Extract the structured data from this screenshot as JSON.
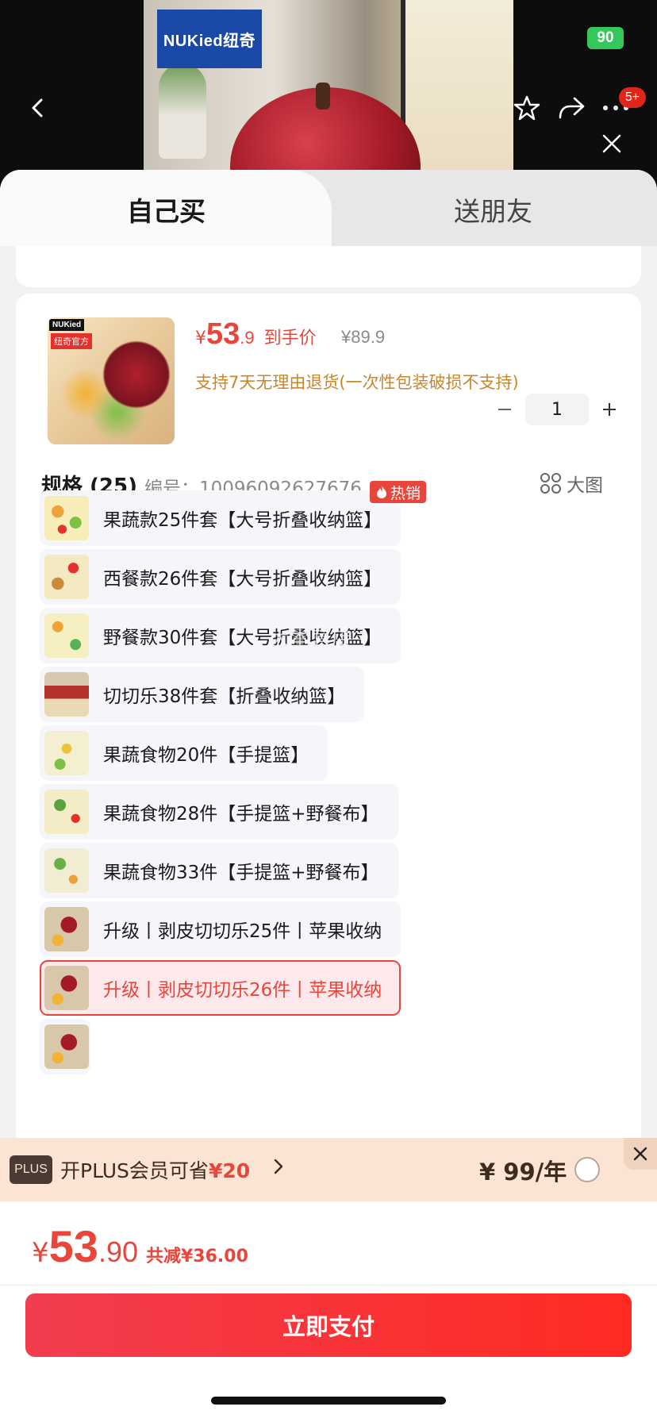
{
  "hero": {
    "brand_logo": "NUKied纽奇",
    "battery": "90",
    "cart_badge": "5+"
  },
  "tabs": [
    {
      "label": "自己买",
      "active": true
    },
    {
      "label": "送朋友",
      "active": false
    }
  ],
  "product": {
    "price_symbol": "¥",
    "price_int": "53",
    "price_dec": ".9",
    "price_tag": "到手价",
    "original_price": "¥89.9",
    "return_note": "支持7天无理由退货(一次性包装破损不支持)",
    "quantity": "1",
    "thumb_tag": "NUKied",
    "thumb_tag2": "纽奇官方"
  },
  "spec": {
    "title": "规格 (25)",
    "sku": "编号：10096092627676",
    "big_image_label": "大图",
    "hot_label": "热销",
    "watermark": "大本营店",
    "variants": [
      {
        "label": "果蔬款25件套【大号折叠收纳篮】",
        "selected": false
      },
      {
        "label": "西餐款26件套【大号折叠收纳篮】",
        "selected": false
      },
      {
        "label": "野餐款30件套【大号折叠收纳篮】",
        "selected": false
      },
      {
        "label": "切切乐38件套【折叠收纳篮】",
        "selected": false
      },
      {
        "label": "果蔬食物20件【手提篮】",
        "selected": false
      },
      {
        "label": "果蔬食物28件【手提篮+野餐布】",
        "selected": false
      },
      {
        "label": "果蔬食物33件【手提篮+野餐布】",
        "selected": false
      },
      {
        "label": "升级丨剥皮切切乐25件丨苹果收纳",
        "selected": false
      },
      {
        "label": "升级丨剥皮切切乐26件丨苹果收纳",
        "selected": true
      }
    ]
  },
  "plus": {
    "badge": "PLUS",
    "text_prefix": "开PLUS会员可省",
    "save_amount": "¥20",
    "price": "¥ 99/年"
  },
  "total": {
    "symbol": "¥",
    "int": "53",
    "dec": ".90",
    "reduce": "共减¥36.00"
  },
  "pay": {
    "label": "立即支付"
  },
  "colors": {
    "accent_red": "#e8463b",
    "selected_bg": "#fde9ec",
    "return_note": "#c8862f",
    "plus_bar_bg": "#fbe4d4"
  }
}
